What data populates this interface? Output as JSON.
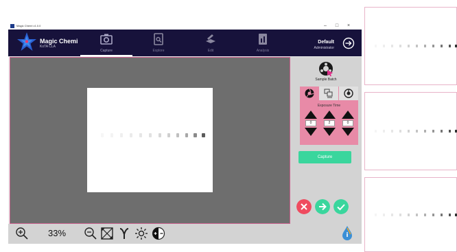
{
  "window": {
    "title": "Magic Chemi v1.0.0",
    "controls": [
      "–",
      "□",
      "×"
    ]
  },
  "brand": {
    "name": "Magic Chemi",
    "subtitle": "KoTA CLA"
  },
  "nav": {
    "tabs": [
      {
        "label": "Capture",
        "icon": "camera-icon",
        "active": true
      },
      {
        "label": "Explore",
        "icon": "explore-icon",
        "active": false
      },
      {
        "label": "Edit",
        "icon": "edit-icon",
        "active": false
      },
      {
        "label": "Analysis",
        "icon": "analysis-icon",
        "active": false
      }
    ]
  },
  "user": {
    "name": "Default",
    "role": "Administrator"
  },
  "sidebar": {
    "sample_batch_label": "Sample Batch",
    "exposure": {
      "label": "Exposure Time",
      "values": [
        "0",
        "2",
        "0"
      ]
    },
    "capture_label": "Capture"
  },
  "bottombar": {
    "zoom": "33%"
  },
  "colors": {
    "nav_bg": "#17123b",
    "accent_pink": "#e88aa7",
    "capture_green": "#3ad69d",
    "cancel_red": "#ef4b5f",
    "next_green": "#3ad69d",
    "ok_green": "#3ad69d",
    "viewer_bg": "#6e6e6e"
  }
}
